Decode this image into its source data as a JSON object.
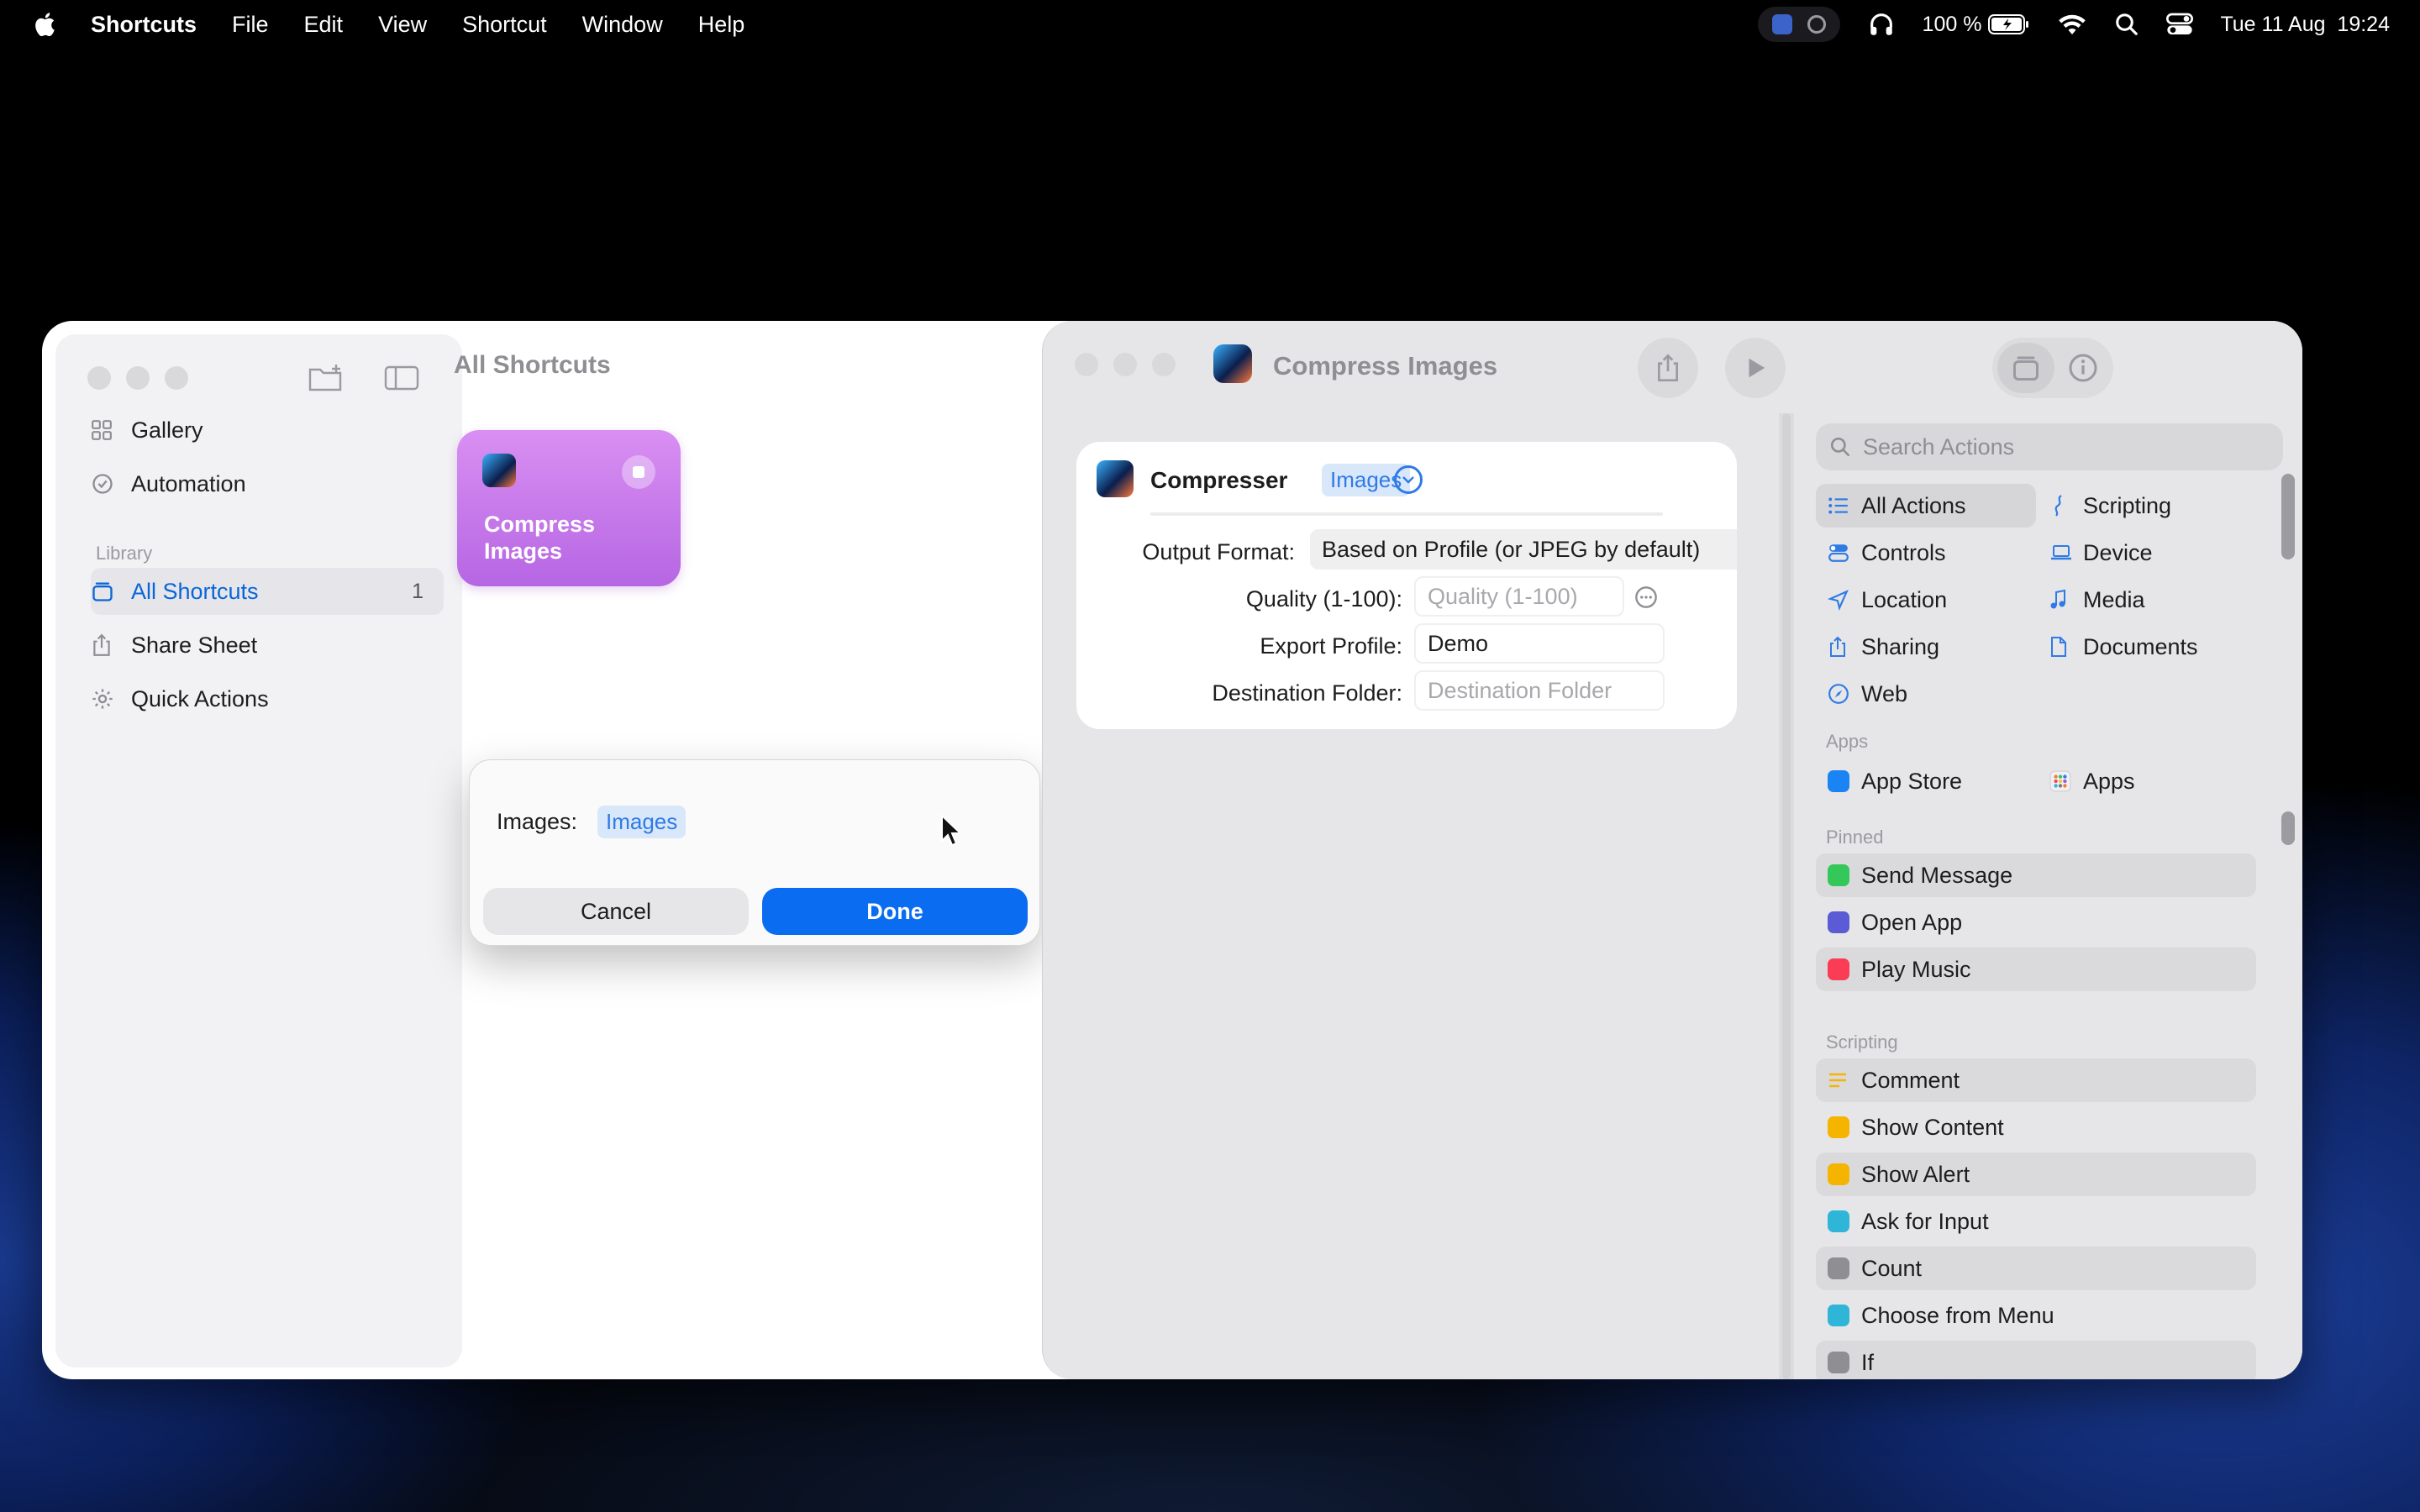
{
  "menubar": {
    "app_name": "Shortcuts",
    "menus": [
      "File",
      "Edit",
      "View",
      "Shortcut",
      "Window",
      "Help"
    ],
    "battery": "100 %",
    "datetime": "Tue 11 Aug  19:24"
  },
  "sidebar": {
    "items": [
      {
        "label": "Gallery",
        "icon": "grid-icon"
      },
      {
        "label": "Automation",
        "icon": "clock-check-icon"
      }
    ],
    "library_title": "Library",
    "library_items": [
      {
        "label": "All Shortcuts",
        "count": "1",
        "icon": "stack-icon"
      },
      {
        "label": "Share Sheet",
        "icon": "share-icon"
      },
      {
        "label": "Quick Actions",
        "icon": "gear-icon"
      }
    ]
  },
  "content": {
    "title": "All Shortcuts",
    "tile": {
      "label": "Compress Images",
      "color": "#c77ae9"
    }
  },
  "dialog": {
    "field_label": "Images:",
    "token": "Images",
    "cancel_label": "Cancel",
    "done_label": "Done"
  },
  "editor": {
    "title": "Compress Images",
    "action": {
      "name": "Compresser",
      "token": "Images",
      "params": [
        {
          "label": "Output Format:",
          "value": "Based on Profile (or JPEG by default)",
          "kind": "filled"
        },
        {
          "label": "Quality (1-100):",
          "value": "Quality (1-100)",
          "kind": "empty"
        },
        {
          "label": "Export Profile:",
          "value": "Demo",
          "kind": "filled"
        },
        {
          "label": "Destination Folder:",
          "value": "Destination Folder",
          "kind": "empty"
        }
      ]
    }
  },
  "library": {
    "search_placeholder": "Search Actions",
    "categories_left": [
      "All Actions",
      "Controls",
      "Location",
      "Sharing",
      "Web"
    ],
    "categories_right": [
      "Scripting",
      "Device",
      "Media",
      "Documents"
    ],
    "apps_title": "Apps",
    "apps": [
      "App Store",
      "Apps"
    ],
    "pinned_title": "Pinned",
    "pinned": [
      "Send Message",
      "Open App",
      "Play Music"
    ],
    "scripting_title": "Scripting",
    "scripting": [
      "Comment",
      "Show Content",
      "Show Alert",
      "Ask for Input",
      "Count",
      "Choose from Menu",
      "If"
    ]
  },
  "colors": {
    "accent": "#0a6cf0",
    "token_bg": "#d9e7fb",
    "token_text": "#2f7be5"
  }
}
